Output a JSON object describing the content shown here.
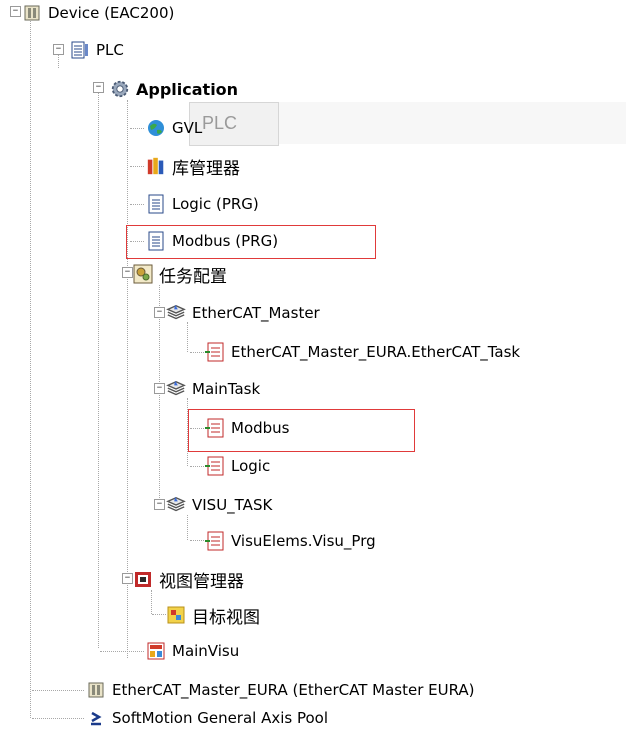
{
  "tree": {
    "device": "Device (EAC200)",
    "plc": "PLC",
    "application": "Application",
    "gvl": "GVL",
    "library_manager": "库管理器",
    "logic_prg": "Logic (PRG)",
    "modbus_prg": "Modbus (PRG)",
    "task_config": "任务配置",
    "ethercat_master": "EtherCAT_Master",
    "ethercat_task": "EtherCAT_Master_EURA.EtherCAT_Task",
    "maintask": "MainTask",
    "maintask_modbus": "Modbus",
    "maintask_logic": "Logic",
    "visu_task": "VISU_TASK",
    "visu_prg": "VisuElems.Visu_Prg",
    "view_manager": "视图管理器",
    "target_view": "目标视图",
    "mainvisu": "MainVisu",
    "ethercat_master_eura": "EtherCAT_Master_EURA (EtherCAT Master EURA)",
    "axis_pool": "SoftMotion General Axis Pool"
  },
  "tooltip": {
    "text": "PLC"
  },
  "expand_symbol": "−",
  "colors": {
    "highlight": "#e03a3a",
    "tooltip_bg": "#f1f1f1",
    "tooltip_text": "#9a9a9a"
  }
}
